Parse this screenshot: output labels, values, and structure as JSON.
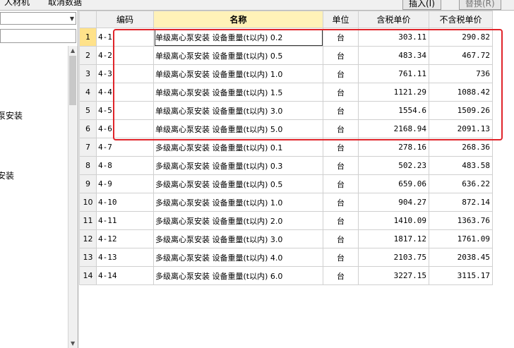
{
  "topbar": {
    "tab1": "人材机",
    "tab2": "取消数据",
    "btn1": "插入(I)",
    "btn2": "替换(R)"
  },
  "leftpanel": {
    "tree_nodes": [
      {
        "label": "泵安装"
      },
      {
        "label": "安装"
      }
    ]
  },
  "grid": {
    "headers": {
      "code": "编码",
      "name": "名称",
      "unit": "单位",
      "price_tax": "含税单价",
      "price_notax": "不含税单价"
    },
    "rows": [
      {
        "n": "1",
        "code": "4-1",
        "name": "单级离心泵安装 设备重量(t以内) 0.2",
        "unit": "台",
        "price_tax": "303.11",
        "price_notax": "290.82"
      },
      {
        "n": "2",
        "code": "4-2",
        "name": "单级离心泵安装 设备重量(t以内) 0.5",
        "unit": "台",
        "price_tax": "483.34",
        "price_notax": "467.72"
      },
      {
        "n": "3",
        "code": "4-3",
        "name": "单级离心泵安装 设备重量(t以内) 1.0",
        "unit": "台",
        "price_tax": "761.11",
        "price_notax": "736"
      },
      {
        "n": "4",
        "code": "4-4",
        "name": "单级离心泵安装 设备重量(t以内) 1.5",
        "unit": "台",
        "price_tax": "1121.29",
        "price_notax": "1088.42"
      },
      {
        "n": "5",
        "code": "4-5",
        "name": "单级离心泵安装 设备重量(t以内) 3.0",
        "unit": "台",
        "price_tax": "1554.6",
        "price_notax": "1509.26"
      },
      {
        "n": "6",
        "code": "4-6",
        "name": "单级离心泵安装 设备重量(t以内) 5.0",
        "unit": "台",
        "price_tax": "2168.94",
        "price_notax": "2091.13"
      },
      {
        "n": "7",
        "code": "4-7",
        "name": "多级离心泵安装 设备重量(t以内) 0.1",
        "unit": "台",
        "price_tax": "278.16",
        "price_notax": "268.36"
      },
      {
        "n": "8",
        "code": "4-8",
        "name": "多级离心泵安装 设备重量(t以内) 0.3",
        "unit": "台",
        "price_tax": "502.23",
        "price_notax": "483.58"
      },
      {
        "n": "9",
        "code": "4-9",
        "name": "多级离心泵安装 设备重量(t以内) 0.5",
        "unit": "台",
        "price_tax": "659.06",
        "price_notax": "636.22"
      },
      {
        "n": "10",
        "code": "4-10",
        "name": "多级离心泵安装 设备重量(t以内) 1.0",
        "unit": "台",
        "price_tax": "904.27",
        "price_notax": "872.14"
      },
      {
        "n": "11",
        "code": "4-11",
        "name": "多级离心泵安装 设备重量(t以内) 2.0",
        "unit": "台",
        "price_tax": "1410.09",
        "price_notax": "1363.76"
      },
      {
        "n": "12",
        "code": "4-12",
        "name": "多级离心泵安装 设备重量(t以内) 3.0",
        "unit": "台",
        "price_tax": "1817.12",
        "price_notax": "1761.09"
      },
      {
        "n": "13",
        "code": "4-13",
        "name": "多级离心泵安装 设备重量(t以内) 4.0",
        "unit": "台",
        "price_tax": "2103.75",
        "price_notax": "2038.45"
      },
      {
        "n": "14",
        "code": "4-14",
        "name": "多级离心泵安装 设备重量(t以内) 6.0",
        "unit": "台",
        "price_tax": "3227.15",
        "price_notax": "3115.17"
      }
    ]
  },
  "colors": {
    "highlight": "#e0242a",
    "header_name_bg": "#fff2b8",
    "selected_row_number": "#ffe28a"
  }
}
